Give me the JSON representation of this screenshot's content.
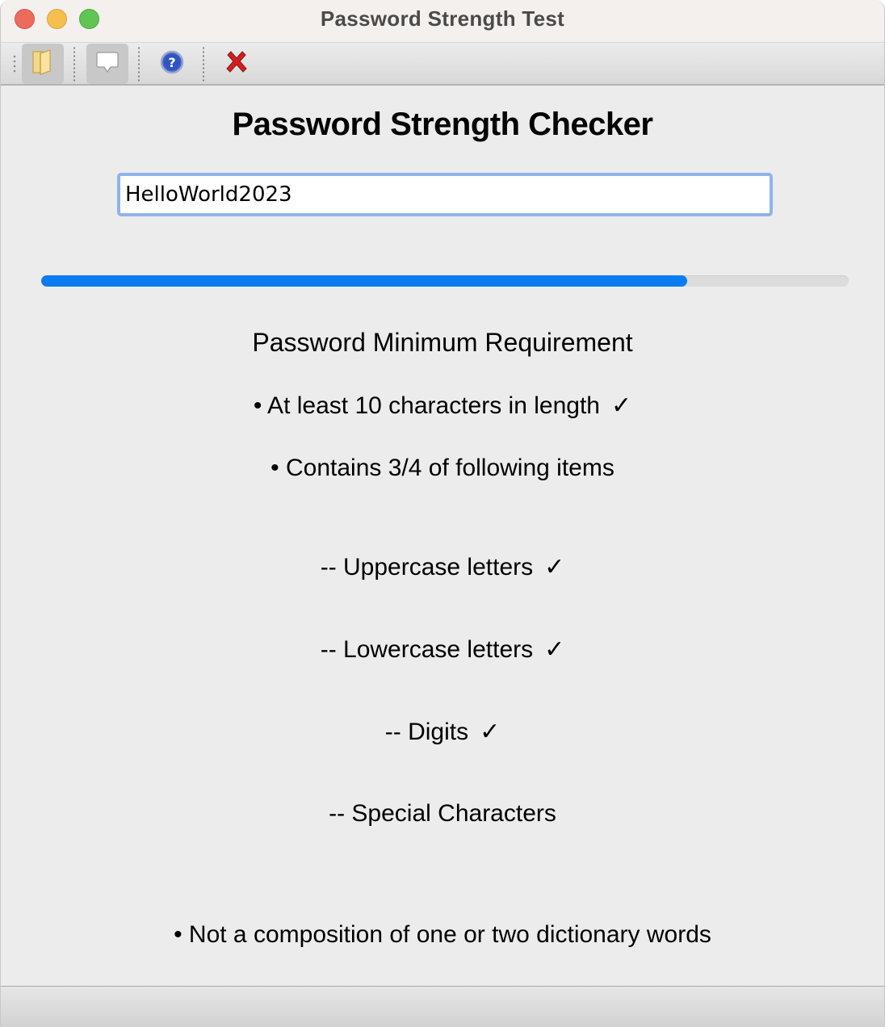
{
  "window": {
    "title": "Password Strength Test"
  },
  "toolbar": {
    "buttons": [
      {
        "icon": "folder-icon"
      },
      {
        "icon": "speech-bubble-icon"
      },
      {
        "icon": "help-icon"
      },
      {
        "icon": "close-x-icon"
      }
    ]
  },
  "main": {
    "heading": "Password Strength Checker",
    "password_value": "HelloWorld2023",
    "strength_fraction": 0.8,
    "requirements_title": "Password Minimum Requirement",
    "items": {
      "length": {
        "text": "• At least 10 characters in length",
        "check": "✓"
      },
      "contains": {
        "text": "• Contains 3/4 of following items"
      },
      "uppercase": {
        "text": "-- Uppercase letters",
        "check": "✓"
      },
      "lowercase": {
        "text": "-- Lowercase letters",
        "check": "✓"
      },
      "digits": {
        "text": "-- Digits",
        "check": "✓"
      },
      "special": {
        "text": "-- Special Characters"
      },
      "dictionary": {
        "text": "• Not a composition of one or two dictionary words"
      }
    }
  },
  "colors": {
    "progress": "#0a7cf2",
    "focus_ring": "#8fb3ec"
  }
}
